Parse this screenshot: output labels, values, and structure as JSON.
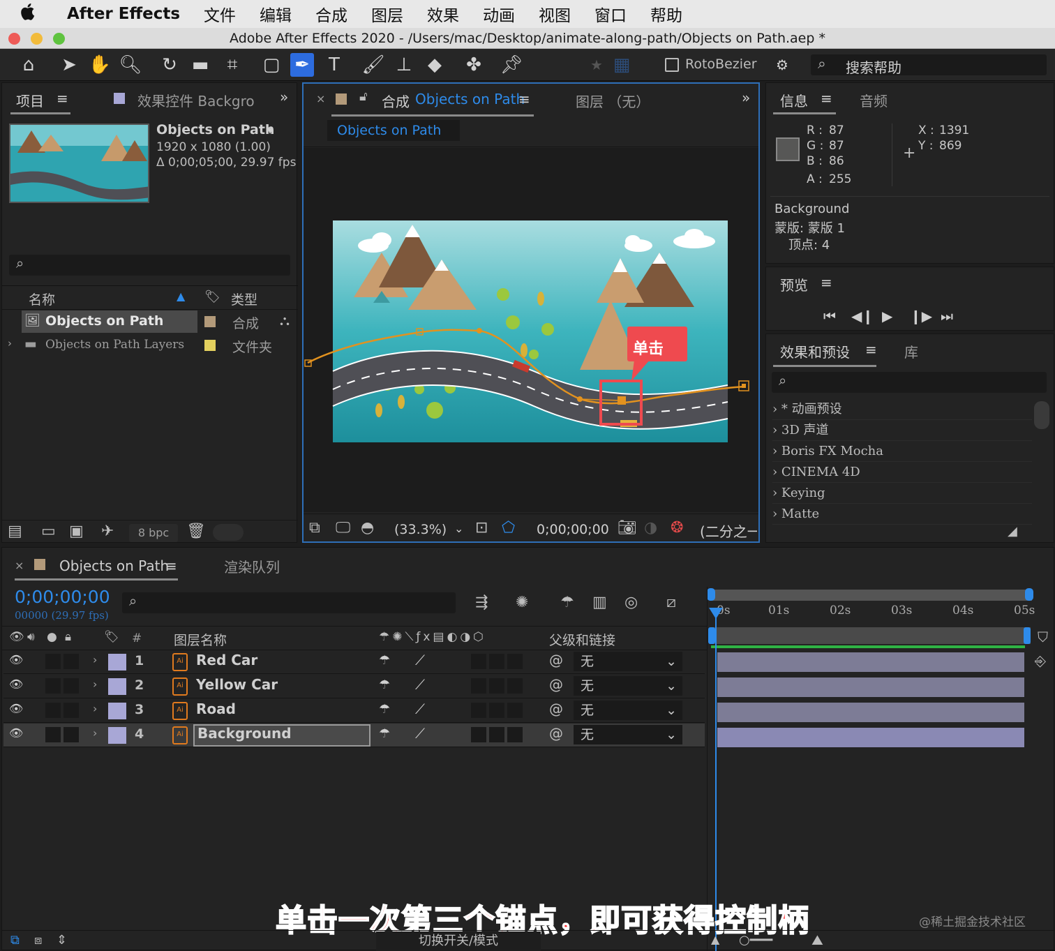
{
  "menubar": {
    "apple": "",
    "app_name": "After Effects",
    "items": [
      "文件",
      "编辑",
      "合成",
      "图层",
      "效果",
      "动画",
      "视图",
      "窗口",
      "帮助"
    ]
  },
  "window": {
    "title": "Adobe After Effects 2020 - /Users/mac/Desktop/animate-along-path/Objects on Path.aep *"
  },
  "toolbar": {
    "rotobezier_label": "RotoBezier",
    "search_help": "搜索帮助",
    "tool_icons": [
      "home-icon",
      "selection-icon",
      "hand-icon",
      "zoom-icon",
      "rotate-icon",
      "camera-icon",
      "pan-behind-icon",
      "rectangle-icon",
      "pen-icon",
      "text-icon",
      "brush-icon",
      "clone-stamp-icon",
      "eraser-icon",
      "roto-brush-icon",
      "puppet-pin-icon"
    ]
  },
  "project_panel": {
    "tab_project": "项目",
    "tab_effects": "效果控件 Backgro",
    "comp_name": "Objects on Path",
    "comp_size": "1920 x 1080 (1.00)",
    "comp_duration": "Δ 0;00;05;00, 29.97 fps",
    "col_name": "名称",
    "col_type": "类型",
    "items": [
      {
        "name": "Objects on Path",
        "type": "合成",
        "color": "#b39a7a"
      },
      {
        "name": "Objects on Path Layers",
        "type": "文件夹",
        "color": "#e3d05e"
      }
    ],
    "bpc": "8 bpc"
  },
  "comp_panel": {
    "tab_label": "合成",
    "tab_comp_name": "Objects on Path",
    "tab_layer": "图层 （无）",
    "breadcrumb": "Objects on Path",
    "callout": "单击",
    "zoom": "(33.3%)",
    "timecode": "0;00;00;00",
    "resolution": "(二分之一"
  },
  "info_panel": {
    "tab_info": "信息",
    "tab_audio": "音频",
    "r_label": "R :",
    "r": "87",
    "g_label": "G :",
    "g": "87",
    "b_label": "B :",
    "b": "86",
    "a_label": "A :",
    "a": "255",
    "x_label": "X :",
    "x": "1391",
    "y_label": "Y :",
    "y": "869",
    "layer": "Background",
    "mask": "蒙版: 蒙版 1",
    "vertex": "顶点: 4"
  },
  "preview_panel": {
    "title": "预览"
  },
  "effects_panel": {
    "tab_effects": "效果和预设",
    "tab_library": "库",
    "items": [
      "* 动画预设",
      "3D 声道",
      "Boris FX Mocha",
      "CINEMA 4D",
      "Keying",
      "Matte"
    ]
  },
  "timeline": {
    "tab_comp": "Objects on Path",
    "tab_render": "渲染队列",
    "timecode": "0;00;00;00",
    "frame_info": "00000 (29.97 fps)",
    "col_hash": "#",
    "col_layer_name": "图层名称",
    "col_parent": "父级和链接",
    "ruler": [
      "0s",
      "01s",
      "02s",
      "03s",
      "04s",
      "05s"
    ],
    "layers": [
      {
        "num": "1",
        "name": "Red Car",
        "parent": "无"
      },
      {
        "num": "2",
        "name": "Yellow Car",
        "parent": "无"
      },
      {
        "num": "3",
        "name": "Road",
        "parent": "无"
      },
      {
        "num": "4",
        "name": "Background",
        "parent": "无"
      }
    ],
    "toggle_modes": "切换开关/模式"
  },
  "caption": "单击一次第三个锚点，即可获得控制柄",
  "watermark": "@稀土掘金技术社区",
  "colors": {
    "accent": "#2e8bea",
    "callout": "#ef4a4f",
    "path": "#e2921f",
    "layer_bar": "#7d7c96",
    "label_lavender": "#a8a7d6",
    "caption": "#ff2e33"
  }
}
